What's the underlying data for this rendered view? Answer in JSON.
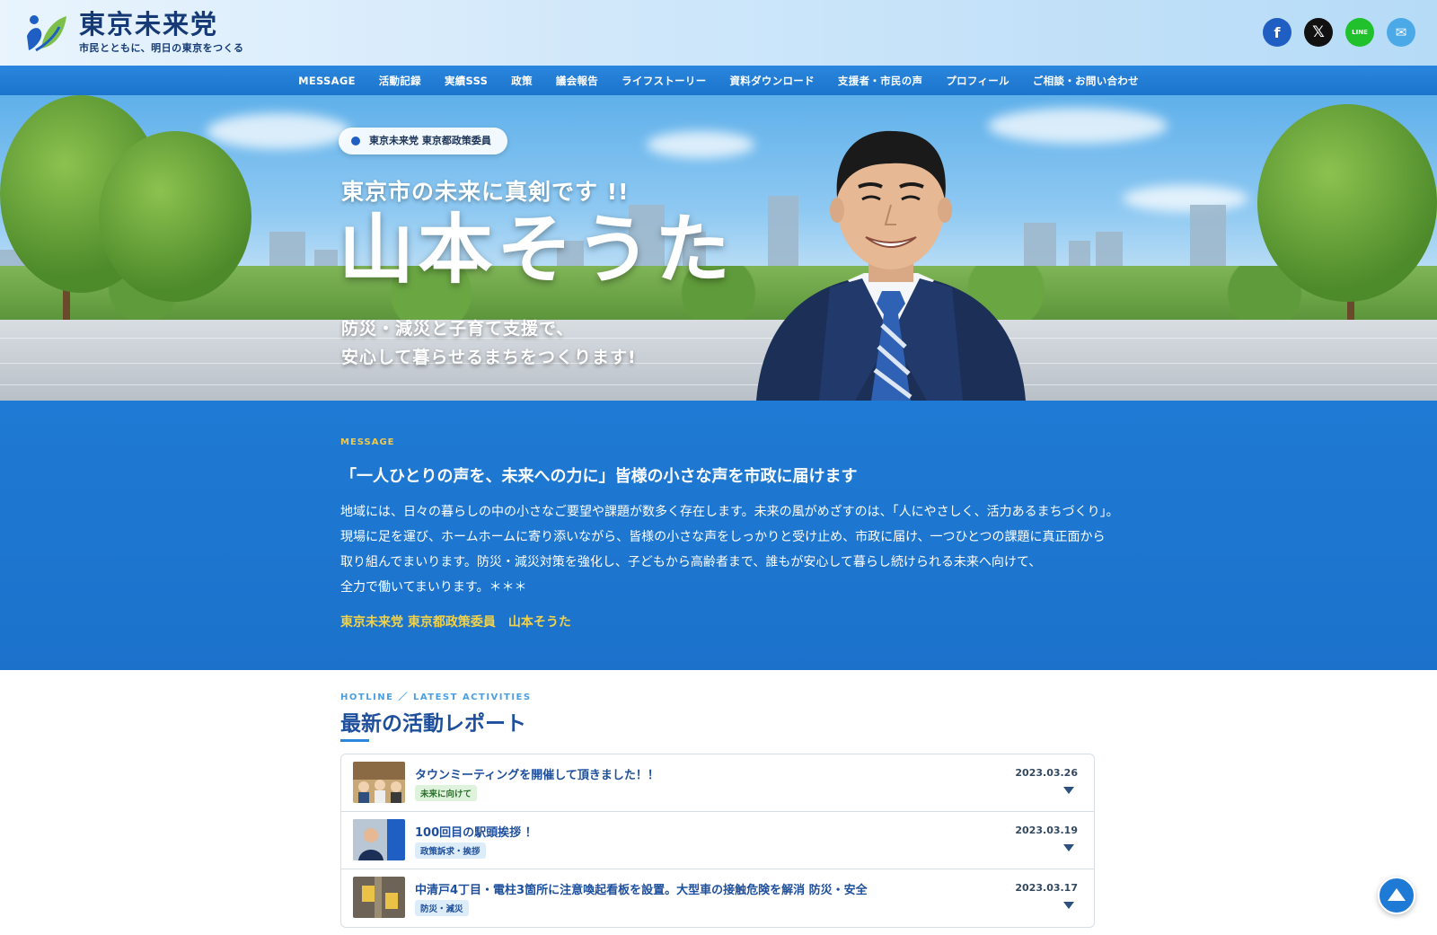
{
  "header": {
    "logo_title": "東京未来党",
    "logo_tagline": "市民とともに、明日の東京をつくる",
    "social": [
      {
        "name": "facebook-icon",
        "glyph": "f"
      },
      {
        "name": "x-icon",
        "glyph": "𝕏"
      },
      {
        "name": "line-icon",
        "glyph": "LINE"
      },
      {
        "name": "mail-icon",
        "glyph": "✉"
      }
    ]
  },
  "nav": {
    "items": [
      "MESSAGE",
      "活動記録",
      "実績SSS",
      "政策",
      "議会報告",
      "ライフストーリー",
      "資料ダウンロード",
      "支援者・市民の声",
      "プロフィール",
      "ご相談・お問い合わせ"
    ]
  },
  "hero": {
    "badge": "東京未来党 東京都政策委員",
    "lead": "東京市の未来に真剣です !!",
    "name": "山本そうた",
    "sub_lines": [
      "防災・減災と子育て支援で、",
      "安心して暮らせるまちをつくります!"
    ]
  },
  "message": {
    "label": "MESSAGE",
    "title": "「一人ひとりの声を、未来への力に」皆様の小さな声を市政に届けます",
    "body_lines": [
      "地域には、日々の暮らしの中の小さなご要望や課題が数多く存在します。未来の風がめざすのは、「人にやさしく、活力あるまちづくり」。",
      "現場に足を運び、ホームホームに寄り添いながら、皆様の小さな声をしっかりと受け止め、市政に届け、一つひとつの課題に真正面から",
      "取り組んでまいります。防災・減災対策を強化し、子どもから高齢者まで、誰もが安心して暮らし続けられる未来へ向けて、",
      "全力で働いてまいります。＊＊＊"
    ],
    "signature": "東京未来党 東京都政策委員　山本そうた"
  },
  "activities": {
    "label": "HOTLINE ／ LATEST ACTIVITIES",
    "title": "最新の活動レポート",
    "items": [
      {
        "title": "タウンミーティングを開催して頂きました！！",
        "tag": "未来に向けて",
        "date": "2023.03.26"
      },
      {
        "title": "100回目の駅頭挨拶 ！",
        "tag": "政策訴求・挨拶",
        "date": "2023.03.19"
      },
      {
        "title": "中清戸4丁目・電柱3箇所に注意喚起看板を設置。大型車の接触危険を解消 防災・安全",
        "tag": "防災・減災",
        "date": "2023.03.17"
      }
    ]
  },
  "colors": {
    "brand": "#153a75",
    "accent": "#1f7ad6",
    "highlight": "#f2c84b"
  }
}
